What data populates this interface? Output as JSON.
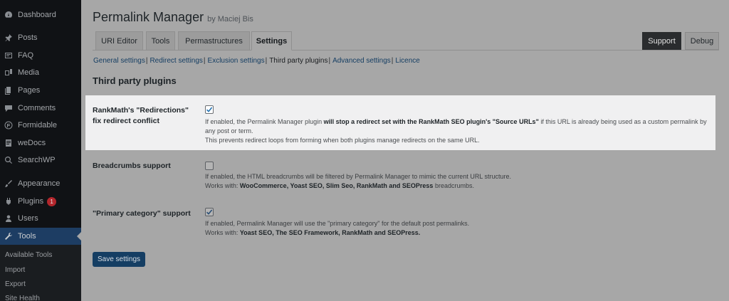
{
  "sidebar": {
    "items": [
      {
        "label": "Dashboard",
        "icon": "dashboard-icon"
      },
      {
        "label": "Posts",
        "icon": "pin-icon"
      },
      {
        "label": "FAQ",
        "icon": "faq-icon"
      },
      {
        "label": "Media",
        "icon": "media-icon"
      },
      {
        "label": "Pages",
        "icon": "pages-icon"
      },
      {
        "label": "Comments",
        "icon": "comment-icon"
      },
      {
        "label": "Formidable",
        "icon": "formidable-icon"
      },
      {
        "label": "weDocs",
        "icon": "docs-icon"
      },
      {
        "label": "SearchWP",
        "icon": "search-icon"
      },
      {
        "label": "Appearance",
        "icon": "brush-icon"
      },
      {
        "label": "Plugins",
        "icon": "plugin-icon",
        "badge": "1"
      },
      {
        "label": "Users",
        "icon": "users-icon"
      },
      {
        "label": "Tools",
        "icon": "wrench-icon",
        "active": true
      }
    ],
    "submenu": [
      "Available Tools",
      "Import",
      "Export",
      "Site Health"
    ]
  },
  "header": {
    "title": "Permalink Manager",
    "byline": "by Maciej Bis"
  },
  "tabs": [
    "URI Editor",
    "Tools",
    "Permastructures",
    "Settings"
  ],
  "active_tab": "Settings",
  "right_buttons": {
    "support": "Support",
    "debug": "Debug"
  },
  "subnav": {
    "items": [
      "General settings",
      "Redirect settings",
      "Exclusion settings",
      "Third party plugins",
      "Advanced settings",
      "Licence"
    ],
    "separator": "|",
    "current": "Third party plugins"
  },
  "section_title": "Third party plugins",
  "settings": {
    "rankmath": {
      "label_line1": "RankMath's \"Redirections\"",
      "label_line2": "fix redirect conflict",
      "checked": true,
      "desc_pre": "If enabled, the Permalink Manager plugin ",
      "desc_bold": "will stop a redirect set with the RankMath SEO plugin's \"Source URLs\"",
      "desc_post": " if this URL is already being used as a custom permalink by",
      "desc_line2": "any post or term.",
      "desc_line3": "This prevents redirect loops from forming when both plugins manage redirects on the same URL."
    },
    "breadcrumbs": {
      "label": "Breadcrumbs support",
      "checked": false,
      "desc_line1": "If enabled, the HTML breadcrumbs will be filtered by Permalink Manager to mimic the current URL structure.",
      "works_prefix": "Works with: ",
      "works_bold": "WooCommerce, Yoast SEO, Slim Seo, RankMath and SEOPress",
      "works_suffix": " breadcrumbs."
    },
    "primary_category": {
      "label": "\"Primary category\" support",
      "checked": true,
      "desc_line1": "If enabled, Permalink Manager will use the \"primary category\" for the default post permalinks.",
      "works_prefix": "Works with: ",
      "works_bold": "Yoast SEO, The SEO Framework, RankMath and SEOPress."
    }
  },
  "save_button": "Save settings",
  "colors": {
    "sidebar_bg": "#101215",
    "active_menu": "#1d3d63",
    "page_bg": "#a7a7a7",
    "highlight_bg": "#f0f0f1",
    "link": "#153e63",
    "badge": "#b3262c",
    "checkmark": "#2271b1"
  }
}
